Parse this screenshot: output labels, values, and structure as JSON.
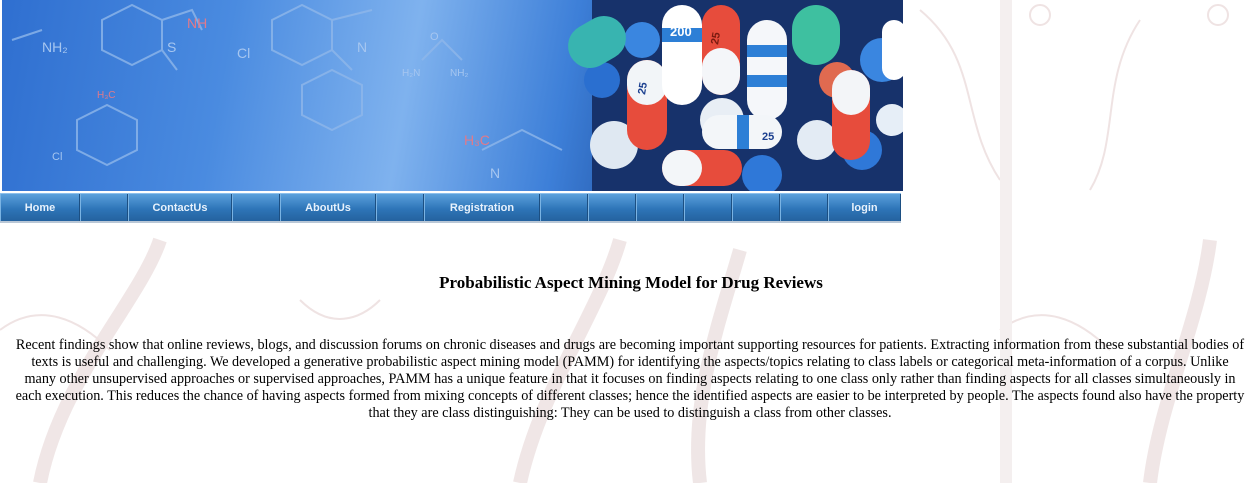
{
  "banner": {
    "image_description": "drug pills banner"
  },
  "nav": {
    "items": [
      {
        "label": "Home"
      },
      {
        "label": ""
      },
      {
        "label": "ContactUs"
      },
      {
        "label": ""
      },
      {
        "label": "AboutUs"
      },
      {
        "label": ""
      },
      {
        "label": "Registration"
      },
      {
        "label": ""
      },
      {
        "label": ""
      },
      {
        "label": ""
      },
      {
        "label": ""
      },
      {
        "label": ""
      },
      {
        "label": ""
      },
      {
        "label": "login"
      }
    ]
  },
  "main": {
    "title": "Probabilistic Aspect Mining Model for Drug Reviews",
    "abstract": "Recent findings show that online reviews, blogs, and discussion forums on chronic diseases and drugs are becoming important supporting resources for patients. Extracting information from these substantial bodies of texts is useful and challenging. We developed a generative probabilistic aspect mining model (PAMM) for identifying the aspects/topics relating to class labels or categorical meta-information of a corpus. Unlike many other unsupervised approaches or supervised approaches, PAMM has a unique feature in that it focuses on finding aspects relating to one class only rather than finding aspects for all classes simultaneously in each execution. This reduces the chance of having aspects formed from mixing concepts of different classes; hence the identified aspects are easier to be interpreted by people. The aspects found also have the property that they are class distinguishing: They can be used to distinguish a class from other classes."
  },
  "banner_text": {
    "nh2": "NH₂",
    "nh": "NH",
    "cl1": "Cl",
    "n1": "N",
    "h2n": "H₂N",
    "nh2b": "NH₂",
    "o1": "O",
    "h3c1": "H₃C",
    "h3c2": "H₃C",
    "n2": "N",
    "cl2": "Cl",
    "s": "S",
    "pill1": "25",
    "pill2": "200",
    "pill3": "25",
    "pill4": "25"
  }
}
